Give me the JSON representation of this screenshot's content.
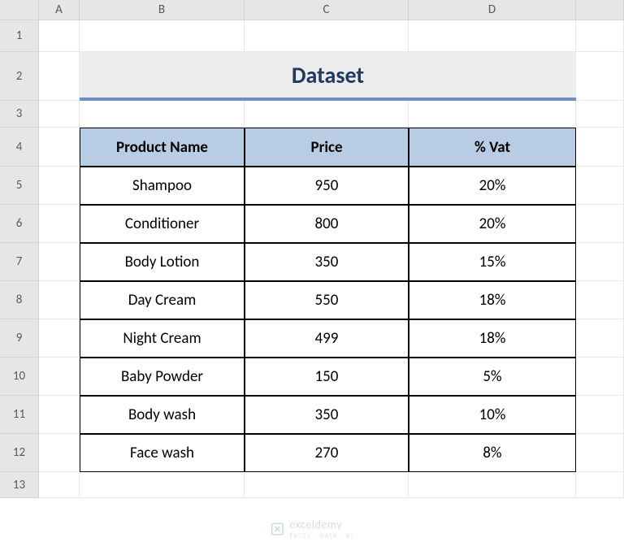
{
  "columns": [
    "A",
    "B",
    "C",
    "D"
  ],
  "rows": [
    "1",
    "2",
    "3",
    "4",
    "5",
    "6",
    "7",
    "8",
    "9",
    "10",
    "11",
    "12",
    "13"
  ],
  "title": "Dataset",
  "headers": {
    "product": "Product Name",
    "price": "Price",
    "vat": "% Vat"
  },
  "data": [
    {
      "product": "Shampoo",
      "price": "950",
      "vat": "20%"
    },
    {
      "product": "Conditioner",
      "price": "800",
      "vat": "20%"
    },
    {
      "product": "Body Lotion",
      "price": "350",
      "vat": "15%"
    },
    {
      "product": "Day Cream",
      "price": "550",
      "vat": "18%"
    },
    {
      "product": "Night Cream",
      "price": "499",
      "vat": "18%"
    },
    {
      "product": "Baby Powder",
      "price": "150",
      "vat": "5%"
    },
    {
      "product": "Body wash",
      "price": "350",
      "vat": "10%"
    },
    {
      "product": "Face wash",
      "price": "270",
      "vat": "8%"
    }
  ],
  "watermark": {
    "brand": "exceldemy",
    "tagline": "EXCEL · DATA · BI"
  }
}
